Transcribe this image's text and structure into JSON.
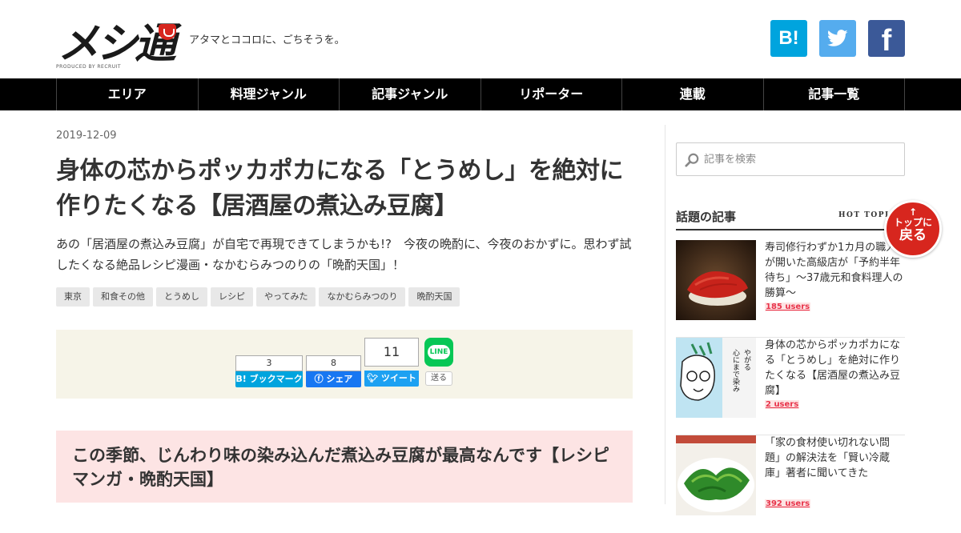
{
  "header": {
    "logo_text": "メシ通",
    "logo_sub": "PRODUCED BY RECRUIT",
    "tagline": "アタマとココロに、ごちそうを。",
    "social": {
      "hatena_label": "B!",
      "facebook_label": "f"
    }
  },
  "nav": {
    "items": [
      {
        "label": "エリア"
      },
      {
        "label": "料理ジャンル"
      },
      {
        "label": "記事ジャンル"
      },
      {
        "label": "リポーター"
      },
      {
        "label": "連載"
      },
      {
        "label": "記事一覧"
      }
    ]
  },
  "article": {
    "date": "2019-12-09",
    "title": "身体の芯からポッカポカになる「とうめし」を絶対に作りたくなる【居酒屋の煮込み豆腐】",
    "lead": "あの「居酒屋の煮込み豆腐」が自宅で再現できてしまうかも!?　今夜の晩酌に、今夜のおかずに。思わず試したくなる絶品レシピ漫画・なかむらみつのりの「晩酌天国」！",
    "tags": [
      "東京",
      "和食その他",
      "とうめし",
      "レシピ",
      "やってみた",
      "なかむらみつのり",
      "晩酌天国"
    ],
    "share": {
      "hatena_count": "3",
      "hatena_label": "B! ブックマーク",
      "facebook_count": "8",
      "facebook_label": "シェア",
      "twitter_count": "11",
      "twitter_label": "ツイート",
      "line_icon_label": "LINE",
      "line_send_label": "送る"
    },
    "section_heading": "この季節、じんわり味の染み込んだ煮込み豆腐が最高なんです【レシピマンガ・晩酌天国】"
  },
  "sidebar": {
    "search_placeholder": "記事を検索",
    "hot_title": "話題の記事",
    "hot_sub": "HOT TOPICS",
    "articles": [
      {
        "title": "寿司修行わずか1カ月の職人が開いた高級店が「予約半年待ち」〜37歳元和食料理人の勝算〜",
        "users": "185 users"
      },
      {
        "title": "身体の芯からポッカポカになる「とうめし」を絶対に作りたくなる【居酒屋の煮込み豆腐】",
        "users": "2 users"
      },
      {
        "title": "「家の食材使い切れない問題」の解決法を「賢い冷蔵庫」著者に聞いてきた",
        "users": "392 users"
      }
    ]
  },
  "to_top": {
    "arrow": "↑",
    "line1": "トップに",
    "line2": "戻る"
  },
  "colors": {
    "nav_bg": "#000000",
    "hatena": "#00a4de",
    "twitter": "#55acee",
    "facebook": "#3b5998",
    "line": "#06c755",
    "accent_red": "#d7261e",
    "section_bg": "#fde4e4",
    "share_bg": "#f6f4e8"
  },
  "icons": {
    "hatena": "hatena-bookmark-icon",
    "twitter": "twitter-bird-icon",
    "facebook": "facebook-f-icon",
    "line": "line-icon",
    "search": "magnifier-icon"
  }
}
